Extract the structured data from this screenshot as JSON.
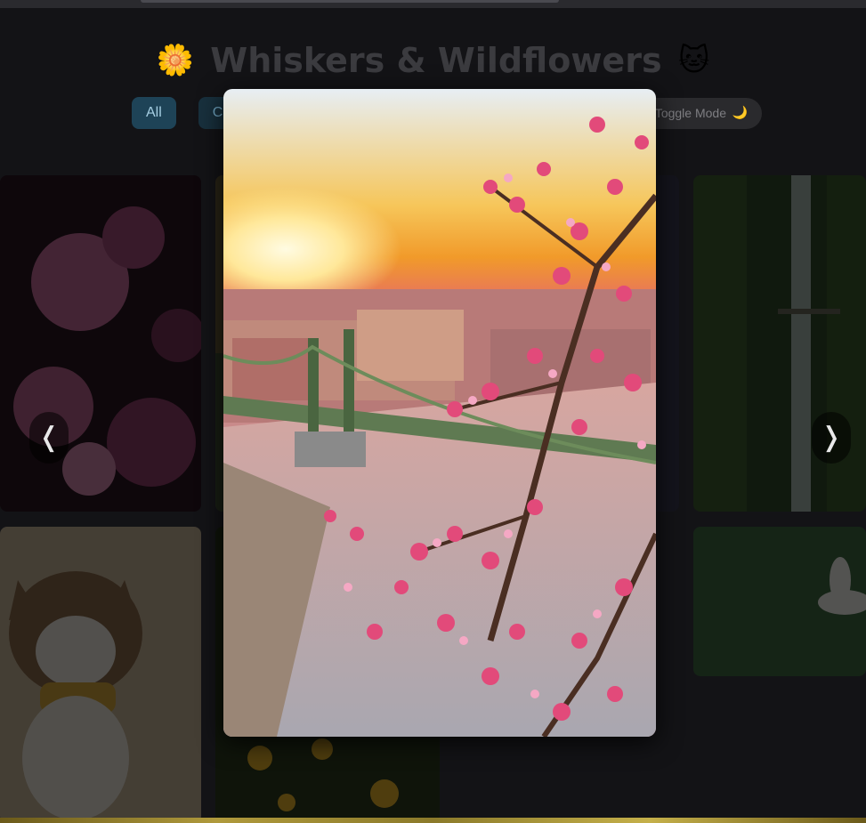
{
  "header": {
    "title": "Whiskers & Wildflowers",
    "left_emoji": "🌼",
    "right_emoji": "🐱"
  },
  "filters": [
    {
      "label": "All",
      "active": true
    },
    {
      "label": "C",
      "active": false
    }
  ],
  "toggle": {
    "label": "Toggle Mode",
    "icon": "🌙"
  },
  "lightbox": {
    "prev_icon": "❬",
    "next_icon": "❭",
    "image": "sunset-bridge-cherry-blossoms"
  },
  "gallery": [
    {
      "subject": "pink-flowers-dark"
    },
    {
      "subject": "waterfall-forest"
    },
    {
      "subject": "smiling-cat-bandana"
    },
    {
      "subject": "yellow-flowers-field"
    },
    {
      "subject": "white-lily-green"
    }
  ],
  "colors": {
    "accent": "#1e4357",
    "chip_text": "#a6cfe3",
    "overlay": "#000000"
  }
}
